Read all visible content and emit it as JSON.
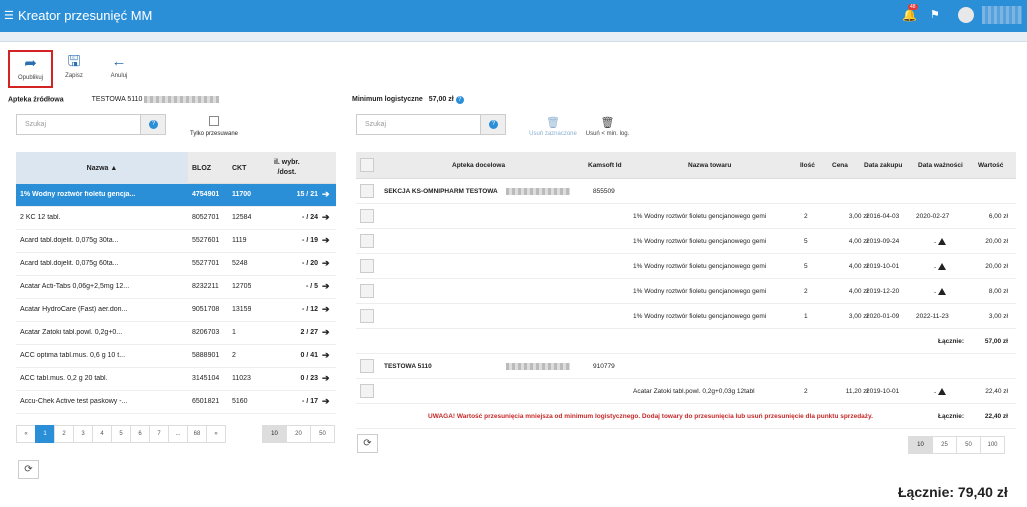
{
  "header": {
    "title": "Kreator przesunięć MM",
    "notification_count": "48"
  },
  "toolbar": {
    "publish": "Opublikuj",
    "save": "Zapisz",
    "cancel": "Anuluj"
  },
  "source": {
    "label": "Apteka źródłowa",
    "value": "TESTOWA 5110"
  },
  "minimum": {
    "label": "Minimum logistyczne",
    "value": "57,00 zł"
  },
  "left": {
    "search_placeholder": "Szukaj",
    "only_moved": "Tylko przesuwane",
    "columns": [
      "Nazwa ▲",
      "BLOZ",
      "CKT",
      "il. wybr.",
      "/dost."
    ],
    "rows": [
      {
        "name": "1% Wodny roztwór fioletu gencja...",
        "bloz": "4754901",
        "ckt": "11700",
        "qty": "15 / 21",
        "sel": true
      },
      {
        "name": "2 KC 12 tabl.",
        "bloz": "8052701",
        "ckt": "12584",
        "qty": "- / 24"
      },
      {
        "name": "Acard tabl.dojelit. 0,075g 30ta...",
        "bloz": "5527601",
        "ckt": "1119",
        "qty": "- / 19"
      },
      {
        "name": "Acard tabl.dojelit. 0,075g 60ta...",
        "bloz": "5527701",
        "ckt": "5248",
        "qty": "- / 20"
      },
      {
        "name": "Acatar Acti-Tabs 0,06g+2,5mg 12...",
        "bloz": "8232211",
        "ckt": "12705",
        "qty": "- / 5"
      },
      {
        "name": "Acatar HydroCare (Fast) aer.don...",
        "bloz": "9051708",
        "ckt": "13159",
        "qty": "- / 12"
      },
      {
        "name": "Acatar Zatoki tabl.powl. 0,2g+0...",
        "bloz": "8206703",
        "ckt": "1",
        "qty": "2 / 27"
      },
      {
        "name": "ACC optima tabl.mus. 0,6 g 10 t...",
        "bloz": "5888901",
        "ckt": "2",
        "qty": "0 / 41"
      },
      {
        "name": "ACC tabl.mus. 0,2 g 20 tabl.",
        "bloz": "3145104",
        "ckt": "11023",
        "qty": "0 / 23"
      },
      {
        "name": "Accu-Chek Active test paskowy -...",
        "bloz": "6501821",
        "ckt": "5160",
        "qty": "- / 17"
      }
    ],
    "pages": [
      "«",
      "1",
      "2",
      "3",
      "4",
      "5",
      "6",
      "7",
      "...",
      "68",
      "»"
    ],
    "page_sizes": [
      "10",
      "20",
      "50"
    ]
  },
  "right": {
    "search_placeholder": "Szukaj",
    "remove_selected": "Usuń zaznaczone",
    "remove_min": "Usuń < min. log.",
    "columns": {
      "apteka": "Apteka docelowa",
      "kamsoft": "Kamsoft Id",
      "towar": "Nazwa towaru",
      "ilosc": "Ilość",
      "cena": "Cena",
      "zakup": "Data zakupu",
      "waznosc": "Data ważności",
      "wartosc": "Wartość"
    },
    "group1": {
      "name": "SEKCJA KS-OMNIPHARM TESTOWA",
      "id": "855509"
    },
    "rows1": [
      {
        "towar": "1% Wodny roztwór fioletu gencjanowego gemi",
        "ilosc": "2",
        "cena": "3,00 zł",
        "zakup": "2016-04-03",
        "waznosc": "2020-02-27",
        "wartosc": "6,00 zł"
      },
      {
        "towar": "1% Wodny roztwór fioletu gencjanowego gemi",
        "ilosc": "5",
        "cena": "4,00 zł",
        "zakup": "2019-09-24",
        "waznosc": "-",
        "wartosc": "20,00 zł",
        "warn": true
      },
      {
        "towar": "1% Wodny roztwór fioletu gencjanowego gemi",
        "ilosc": "5",
        "cena": "4,00 zł",
        "zakup": "2019-10-01",
        "waznosc": "-",
        "wartosc": "20,00 zł",
        "warn": true
      },
      {
        "towar": "1% Wodny roztwór fioletu gencjanowego gemi",
        "ilosc": "2",
        "cena": "4,00 zł",
        "zakup": "2019-12-20",
        "waznosc": "-",
        "wartosc": "8,00 zł",
        "warn": true
      },
      {
        "towar": "1% Wodny roztwór fioletu gencjanowego gemi",
        "ilosc": "1",
        "cena": "3,00 zł",
        "zakup": "2020-01-09",
        "waznosc": "2022-11-23",
        "wartosc": "3,00 zł"
      }
    ],
    "total1_label": "Łącznie:",
    "total1": "57,00 zł",
    "group2": {
      "name": "TESTOWA 5110",
      "id": "910779"
    },
    "rows2": [
      {
        "towar": "Acatar Zatoki tabl.powl. 0,2g+0,03g 12tabl",
        "ilosc": "2",
        "cena": "11,20 zł",
        "zakup": "2019-10-01",
        "waznosc": "-",
        "wartosc": "22,40 zł",
        "warn": true
      }
    ],
    "warning": "UWAGA! Wartość przesunięcia mniejsza od minimum logistycznego. Dodaj towary do przesunięcia lub usuń przesunięcie dla punktu sprzedaży.",
    "total2_label": "Łącznie:",
    "total2": "22,40 zł",
    "page_sizes": [
      "10",
      "25",
      "50",
      "100"
    ]
  },
  "grand_total": "Łącznie: 79,40 zł"
}
